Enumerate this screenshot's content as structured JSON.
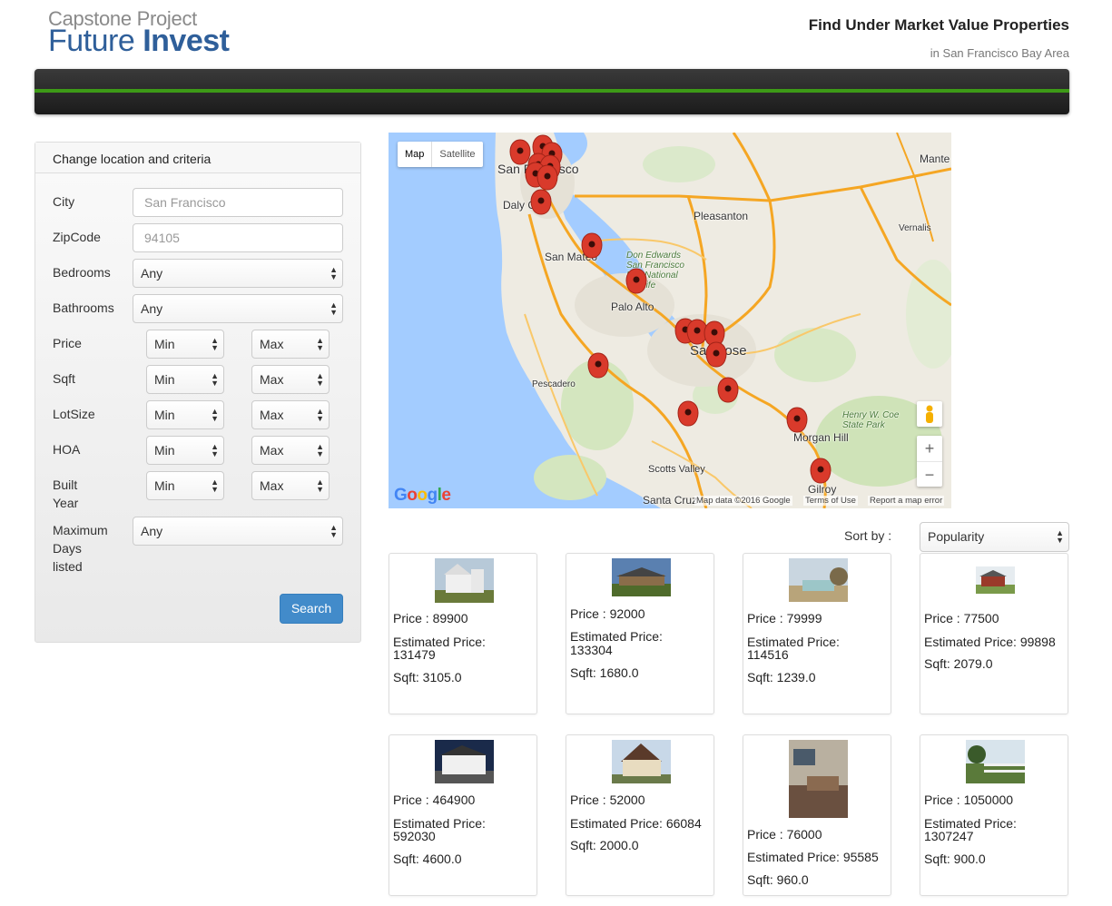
{
  "header": {
    "logo_top": "Capstone Project",
    "logo_word1": "Future",
    "logo_word2": "Invest",
    "title": "Find Under Market Value Properties",
    "subtitle": "in San Francisco Bay Area"
  },
  "panel": {
    "title": "Change location and criteria",
    "city_label": "City",
    "city_placeholder": "San Francisco",
    "zip_label": "ZipCode",
    "zip_placeholder": "94105",
    "bedrooms_label": "Bedrooms",
    "bedrooms_value": "Any",
    "bathrooms_label": "Bathrooms",
    "bathrooms_value": "Any",
    "price_label": "Price",
    "sqft_label": "Sqft",
    "lotsize_label": "LotSize",
    "hoa_label": "HOA",
    "built_label_1": "Built",
    "built_label_2": "Year",
    "days_label_1": "Maximum",
    "days_label_2": "Days",
    "days_label_3": "listed",
    "days_value": "Any",
    "min": "Min",
    "max": "Max",
    "search_label": "Search"
  },
  "map": {
    "type_map": "Map",
    "type_satellite": "Satellite",
    "labels": {
      "sf": "San Francisco",
      "daly": "Daly City",
      "sanmateo": "San Mateo",
      "paloalto": "Palo Alto",
      "sanjose": "San Jose",
      "pleasanton": "Pleasanton",
      "pescadero": "Pescadero",
      "morgan": "Morgan Hill",
      "gilroy": "Gilroy",
      "scotts": "Scotts Valley",
      "santacruz": "Santa Cruz",
      "mante": "Mante",
      "vernalis": "Vernalis",
      "coe": "Henry W. Coe State Park",
      "edwards": "Don Edwards San Francisco Bay National Wildlife"
    },
    "google": "Google",
    "footer_data": "Map data ©2016 Google",
    "footer_terms": "Terms of Use",
    "footer_report": "Report a map error",
    "zoom_in": "+",
    "zoom_out": "−"
  },
  "sort": {
    "label": "Sort by :",
    "value": "Popularity"
  },
  "listings": [
    {
      "price": "Price : 89900",
      "est_label": "Estimated Price:",
      "est": "131479",
      "sqft": "Sqft: 3105.0"
    },
    {
      "price": "Price : 92000",
      "est_label": "Estimated Price:",
      "est": "133304",
      "sqft": "Sqft: 1680.0"
    },
    {
      "price": "Price : 79999",
      "est_label": "Estimated Price:",
      "est": "114516",
      "sqft": "Sqft: 1239.0"
    },
    {
      "price": "Price : 77500",
      "est_label": "Estimated Price: 99898",
      "est": "",
      "sqft": "Sqft: 2079.0"
    },
    {
      "price": "Price : 464900",
      "est_label": "Estimated Price:",
      "est": "592030",
      "sqft": "Sqft: 4600.0"
    },
    {
      "price": "Price : 52000",
      "est_label": "Estimated Price: 66084",
      "est": "",
      "sqft": "Sqft: 2000.0"
    },
    {
      "price": "Price : 76000",
      "est_label": "Estimated Price: 95585",
      "est": "",
      "sqft": "Sqft: 960.0"
    },
    {
      "price": "Price : 1050000",
      "est_label": "Estimated Price:",
      "est": "1307247",
      "sqft": "Sqft: 900.0"
    }
  ],
  "colors": {
    "accent": "#3d9a17",
    "button": "#428bca",
    "logo": "#2f5f9a",
    "marker": "#d93a2b"
  }
}
